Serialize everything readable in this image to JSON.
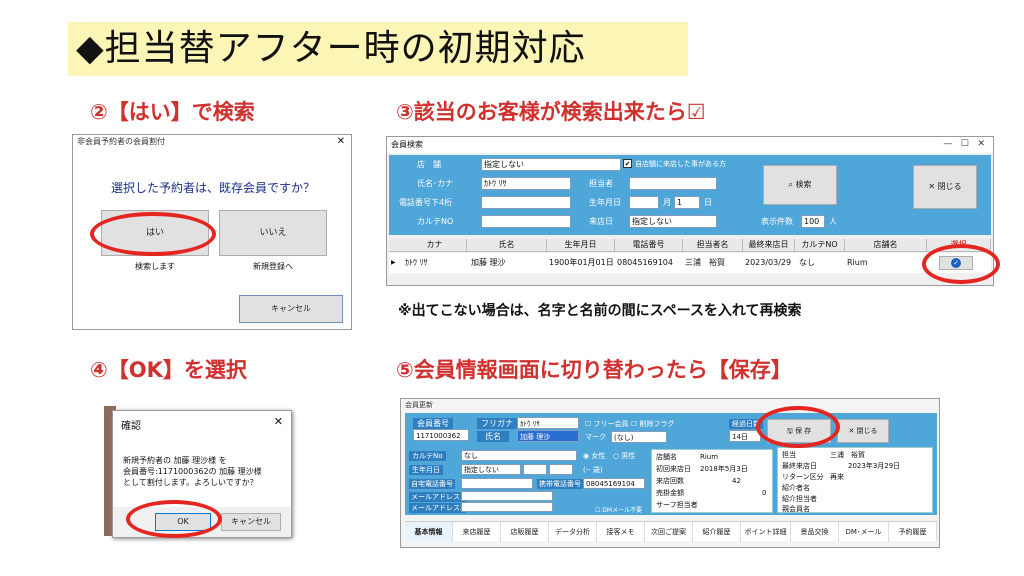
{
  "title": "◆担当替アフター時の初期対応",
  "steps": {
    "s2": "②【はい】で検索",
    "s3": "③該当のお客様が検索出来たら☑",
    "s4": "④【OK】を選択",
    "s5": "⑤会員情報画面に切り替わったら【保存】"
  },
  "note": "※出てこない場合は、名字と名前の間にスペースを入れて再検索",
  "dlg1": {
    "title": "非会員予約者の会員割付",
    "question": "選択した予約者は、既存会員ですか？",
    "yes": "はい",
    "no": "いいえ",
    "yes_sub": "検索します",
    "no_sub": "新規登録へ",
    "cancel": "キャンセル"
  },
  "search": {
    "title": "会員検索",
    "store_label": "店　舗",
    "store_value": "指定しない",
    "own_store_check": "自店舗に来店した事がある方",
    "name_label": "氏名･カナ",
    "name_value": "ｶﾄｳ ﾘｻ",
    "staff_label": "担当者",
    "phone_label": "電話番号下4桁",
    "birth_label": "生年月日",
    "month_unit": "月",
    "month_value": "1",
    "day_unit": "日",
    "chart_label": "カルテNO",
    "visit_label": "来店日",
    "visit_value": "指定しない",
    "count_label": "表示件数",
    "count_value": "100",
    "count_unit": "人",
    "search_btn": "検索",
    "close_btn": "閉じる",
    "columns": [
      "カナ",
      "氏名",
      "生年月日",
      "電話番号",
      "担当者名",
      "最終来店日",
      "カルテNO",
      "店舗名",
      "選択"
    ],
    "row": [
      "ｶﾄｳ ﾘｻ",
      "加藤 理沙",
      "1900年01月01日",
      "08045169104",
      "三浦　裕賀",
      "2023/03/29",
      "なし",
      "Rium"
    ]
  },
  "confirm": {
    "title": "確認",
    "line1": "新規予約者の 加藤 理沙様 を",
    "line2": "会員番号:1171000362の 加藤 理沙様",
    "line3": "として割付します。よろしいですか？",
    "ok": "OK",
    "cancel": "キャンセル"
  },
  "member": {
    "title": "会員更新",
    "no_label": "会員番号",
    "no_value": "1171000362",
    "kana_label": "フリガナ",
    "kana_value": "ｶﾄｳ ﾘｻ",
    "name_label": "氏名",
    "name_value": "加藤 理沙",
    "free_label": "フリー会員",
    "del_label": "削除フラグ",
    "mark_label": "マーク",
    "mark_value": "(なし)",
    "elapsed_label": "経過日数",
    "elapsed_value": "14日",
    "save": "保 存",
    "close": "閉じる",
    "chart_label": "カルテNo",
    "chart_value": "なし",
    "female": "女性",
    "male": "男性",
    "birth_label": "生年月日",
    "birth_value": "指定しない",
    "age": "(-- 歳)",
    "home_label": "自宅電話番号",
    "mobile_label": "携帯電話番号",
    "mobile_value": "08045169104",
    "mail1_label": "メールアドレス1",
    "mail2_label": "メールアドレス2",
    "dm_label": "DMメール不要",
    "store_label": "店舗名",
    "store_value": "Rium",
    "first_label": "初回来店日",
    "first_value": "2018年5月3日",
    "visits_label": "来店回数",
    "visits_value": "42",
    "sales_label": "売掛金額",
    "sales_value": "0",
    "surf_label": "サーフ担当者",
    "staff_label": "担当",
    "staff_value": "三浦　裕賀",
    "last_label": "最終来店日",
    "last_value": "2023年3月29日",
    "return_label": "リターン区分",
    "return_value": "再来",
    "intro_label": "紹介者名",
    "intro_staff_label": "紹介担当者",
    "family_label": "親会員名",
    "tabs": [
      "基本情報",
      "来店履歴",
      "店販履歴",
      "データ分析",
      "接客メモ",
      "次回ご提案",
      "紹介履歴",
      "ポイント詳細",
      "景品交換",
      "DM･メール",
      "予約履歴"
    ]
  },
  "colors": {
    "accent_red": "#e52520",
    "step_red": "#d0302e",
    "panel_blue": "#4fa6d8"
  }
}
